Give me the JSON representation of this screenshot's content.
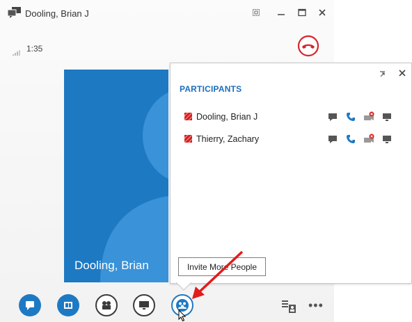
{
  "window": {
    "title": "Dooling, Brian J",
    "icon": "conversation-icon"
  },
  "call": {
    "timer": "1:35",
    "signal_icon": "signal-strength-icon",
    "hangup_icon": "hangup-icon"
  },
  "video": {
    "name": "Dooling, Brian"
  },
  "participants_panel": {
    "heading": "PARTICIPANTS",
    "participants": [
      {
        "name": "Dooling, Brian J",
        "status_color": "#d11f1f"
      },
      {
        "name": "Thierry, Zachary",
        "status_color": "#d11f1f"
      }
    ],
    "invite_label": "Invite More People"
  },
  "toolbar": {
    "buttons": [
      "im-icon",
      "presentation-icon",
      "video-icon",
      "screen-share-icon",
      "participants-icon"
    ],
    "more_label": "•••"
  },
  "colors": {
    "accent": "#1e79c3",
    "heading": "#1b6dbd",
    "hangup": "#d7262d",
    "busy": "#d11f1f",
    "annotation": "#e31b1b"
  }
}
